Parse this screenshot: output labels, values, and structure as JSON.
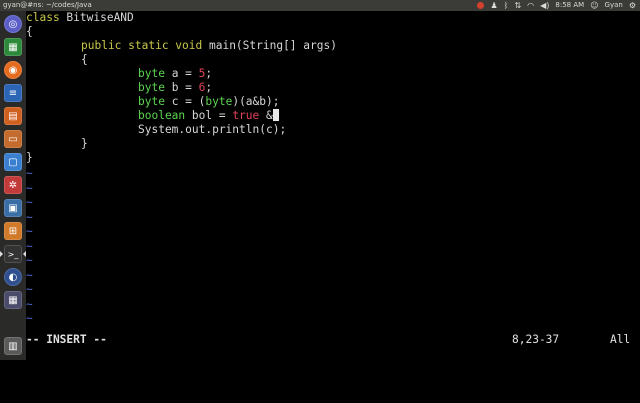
{
  "topbar": {
    "window_title": "gyan@#ns: ~/codes/Java",
    "clock": "8:58 AM",
    "user": "Gyan",
    "tray_icons": [
      "record-icon",
      "tux-icon",
      "bluetooth-icon",
      "transfer-icon",
      "wifi-icon",
      "volume-icon",
      "clock",
      "user-icon",
      "gear-icon"
    ]
  },
  "launcher": {
    "icons": [
      {
        "name": "dash-home-icon",
        "color": "#5b5fc7",
        "glyph": "◎"
      },
      {
        "name": "libreoffice-calc-icon",
        "color": "#2e8a3b",
        "glyph": "▦"
      },
      {
        "name": "firefox-icon",
        "color": "#e56b1f",
        "glyph": "◉"
      },
      {
        "name": "libreoffice-writer-icon",
        "color": "#2c65b5",
        "glyph": "≡"
      },
      {
        "name": "libreoffice-impress-icon",
        "color": "#d06020",
        "glyph": "▤"
      },
      {
        "name": "files-icon",
        "color": "#c46b2e",
        "glyph": "▭"
      },
      {
        "name": "document-viewer-icon",
        "color": "#3a7fd0",
        "glyph": "▢"
      },
      {
        "name": "settings-icon",
        "color": "#c23b3b",
        "glyph": "✲"
      },
      {
        "name": "screenshot-icon",
        "color": "#3a6fa5",
        "glyph": "▣"
      },
      {
        "name": "software-center-icon",
        "color": "#d07a2a",
        "glyph": "⊞"
      },
      {
        "name": "terminal-icon",
        "color": "#3a3a3a",
        "glyph": ">_"
      },
      {
        "name": "eclipse-icon",
        "color": "#2f4f8f",
        "glyph": "◐"
      },
      {
        "name": "workspace-switcher-icon",
        "color": "#4a4a6a",
        "glyph": "▦"
      },
      {
        "name": "trash-icon",
        "color": "#6a6a6a",
        "glyph": "🗑"
      }
    ]
  },
  "editor": {
    "code": {
      "l1_kw": "class",
      "l1_rest": " BitwiseAND",
      "l2": "{",
      "l3_kw": "public static void",
      "l3_rest": " main(String[] args)",
      "l4": "{",
      "l5_type": "byte",
      "l5_mid": " a = ",
      "l5_num": "5",
      "l5_end": ";",
      "l6_type": "byte",
      "l6_mid": " b = ",
      "l6_num": "6",
      "l6_end": ";",
      "l7_type": "byte",
      "l7_mid": " c = (",
      "l7_type2": "byte",
      "l7_end": ")(a&b);",
      "l8_type": "boolean",
      "l8_mid": " bol = ",
      "l8_num": "true",
      "l8_end": " &",
      "l9": "System.out.println(c);",
      "l10": "}",
      "l11": "}"
    },
    "tilde": "~",
    "status": {
      "mode": "-- INSERT --",
      "position": "8,23-37",
      "scroll": "All"
    }
  }
}
